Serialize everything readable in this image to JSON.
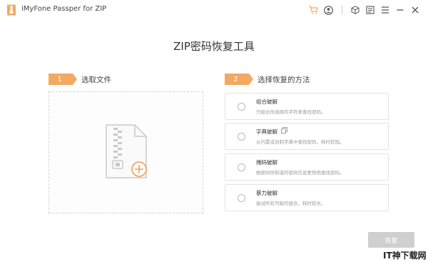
{
  "app": {
    "title": "iMyFone Passper for ZIP"
  },
  "titlebar": {
    "icons": [
      "cart-icon",
      "account-icon",
      "box-icon",
      "feedback-icon",
      "menu-icon",
      "minimize-icon",
      "close-icon"
    ]
  },
  "headline": "ZIP密码恢复工具",
  "steps": [
    {
      "number": "1",
      "label": "选取文件"
    },
    {
      "number": "2",
      "label": "选择恢复的方法"
    }
  ],
  "methods": [
    {
      "title": "组合破解",
      "desc": "只组合你选择的字符来查找密码。"
    },
    {
      "title": "字典破解",
      "desc": "从内置或自制字典中查找密码，耗时较短。"
    },
    {
      "title": "掩码破解",
      "desc": "根据你所知道的密码信息更快地查找密码。"
    },
    {
      "title": "暴力破解",
      "desc": "尝试所有可能的组合，耗时较长。"
    }
  ],
  "recover_label": "恢复",
  "watermark": "IT神下载网",
  "colors": {
    "accent": "#f2a962",
    "button_disabled": "#cfcfcf"
  }
}
